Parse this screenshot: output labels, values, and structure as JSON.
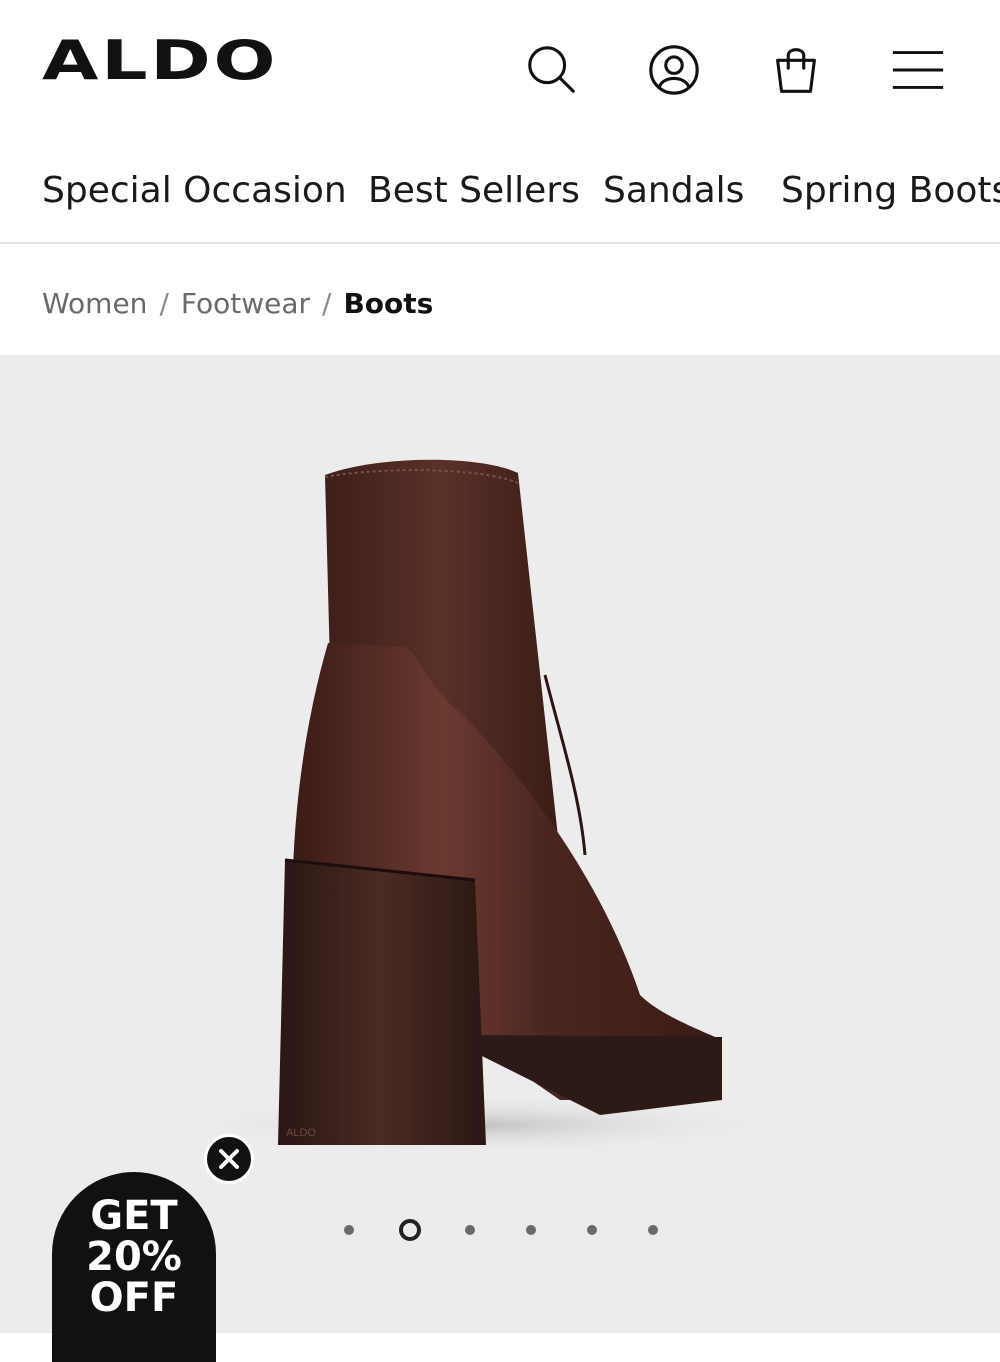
{
  "brand": {
    "logo_text": "ALDO"
  },
  "header_icons": [
    "search-icon",
    "account-icon",
    "bag-icon",
    "menu-icon"
  ],
  "nav": {
    "items": [
      "Special Occasion",
      "Best Sellers",
      "Sandals",
      "Spring Boots"
    ]
  },
  "breadcrumb": {
    "items": [
      "Women",
      "Footwear"
    ],
    "current": "Boots",
    "separator": "/"
  },
  "gallery": {
    "image": "brown-block-heel-ankle-boot",
    "slide_count": 6,
    "active_slide": 2,
    "background": "#ececec"
  },
  "promo": {
    "line1": "GET",
    "line2": "20%",
    "line3": "OFF"
  },
  "colors": {
    "text": "#111111",
    "boot": "#4a2620"
  }
}
